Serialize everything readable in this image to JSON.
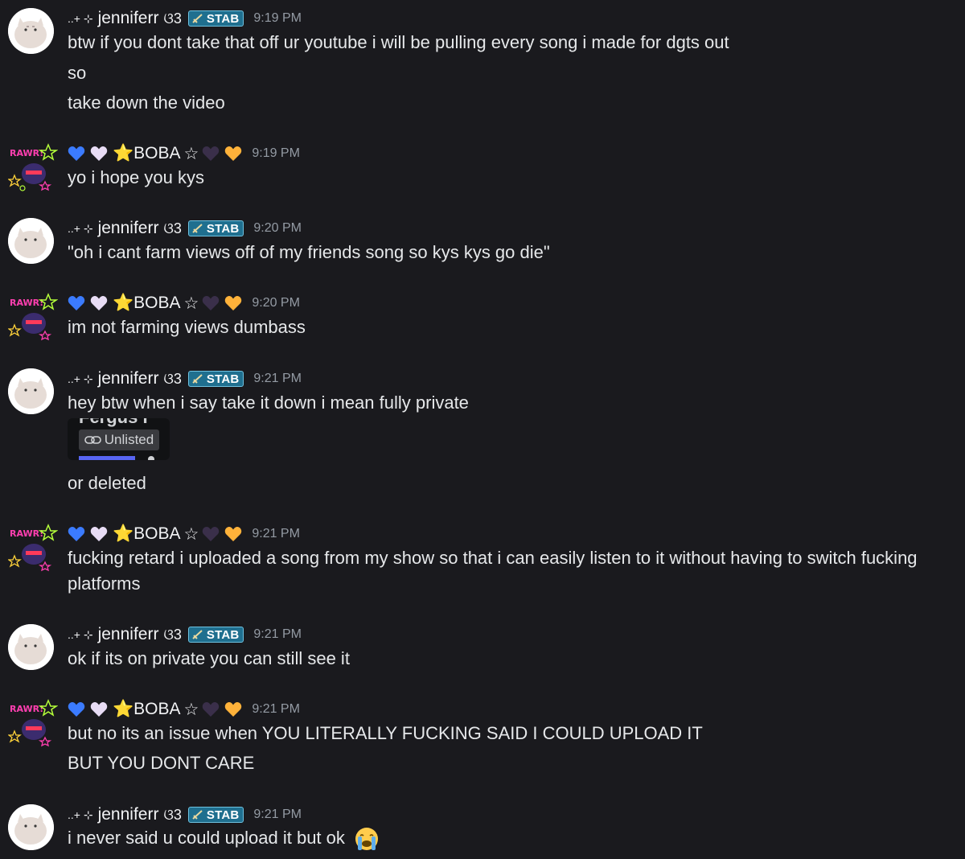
{
  "users": {
    "jenniferr": {
      "prefix": "..+ ⊹",
      "name": "jenniferr",
      "suffix": "ଓ3",
      "badge": "STAB"
    },
    "boba": {
      "name": "⭐BOBA",
      "star": "☆"
    }
  },
  "messages": [
    {
      "author": "jenniferr",
      "time": "9:19 PM",
      "lines": [
        "btw if you dont take that off ur youtube i will be pulling every song i made for dgts out",
        "so",
        "take down the video"
      ]
    },
    {
      "author": "boba",
      "time": "9:19 PM",
      "lines": [
        "yo i hope  you kys"
      ]
    },
    {
      "author": "jenniferr",
      "time": "9:20 PM",
      "lines": [
        "\"oh i cant farm views off of my friends song so kys kys go die\""
      ]
    },
    {
      "author": "boba",
      "time": "9:20 PM",
      "lines": [
        "im not farming views dumbass"
      ]
    },
    {
      "author": "jenniferr",
      "time": "9:21 PM",
      "lines": [
        "hey btw when i say take it down i mean fully private",
        "or deleted"
      ],
      "embed": {
        "title": "Fergus I",
        "pill": "Unlisted"
      }
    },
    {
      "author": "boba",
      "time": "9:21 PM",
      "lines": [
        "fucking retard i uploaded a song from my show so that i can easily listen to it without having to switch fucking platforms"
      ]
    },
    {
      "author": "jenniferr",
      "time": "9:21 PM",
      "lines": [
        "ok if its on private you can still see it"
      ]
    },
    {
      "author": "boba",
      "time": "9:21 PM",
      "lines": [
        "but no its an issue when YOU LITERALLY FUCKING SAID I COULD UPLOAD IT",
        "BUT YOU DONT CARE"
      ]
    },
    {
      "author": "jenniferr",
      "time": "9:21 PM",
      "lines": [
        "i never said u could upload it but ok"
      ]
    }
  ],
  "colors": {
    "background": "#1a1a1e",
    "text": "#e6e8ea",
    "timestamp": "#949ba4",
    "badge": "#1f6f8f",
    "link_bar": "#5865f2"
  },
  "icons": [
    "cat-avatar-icon",
    "boba-avatar-icon",
    "sword-icon",
    "blue-heart-icon",
    "white-heart-icon",
    "black-heart-icon",
    "orange-heart-icon",
    "link-icon",
    "crying-emoji-icon"
  ]
}
